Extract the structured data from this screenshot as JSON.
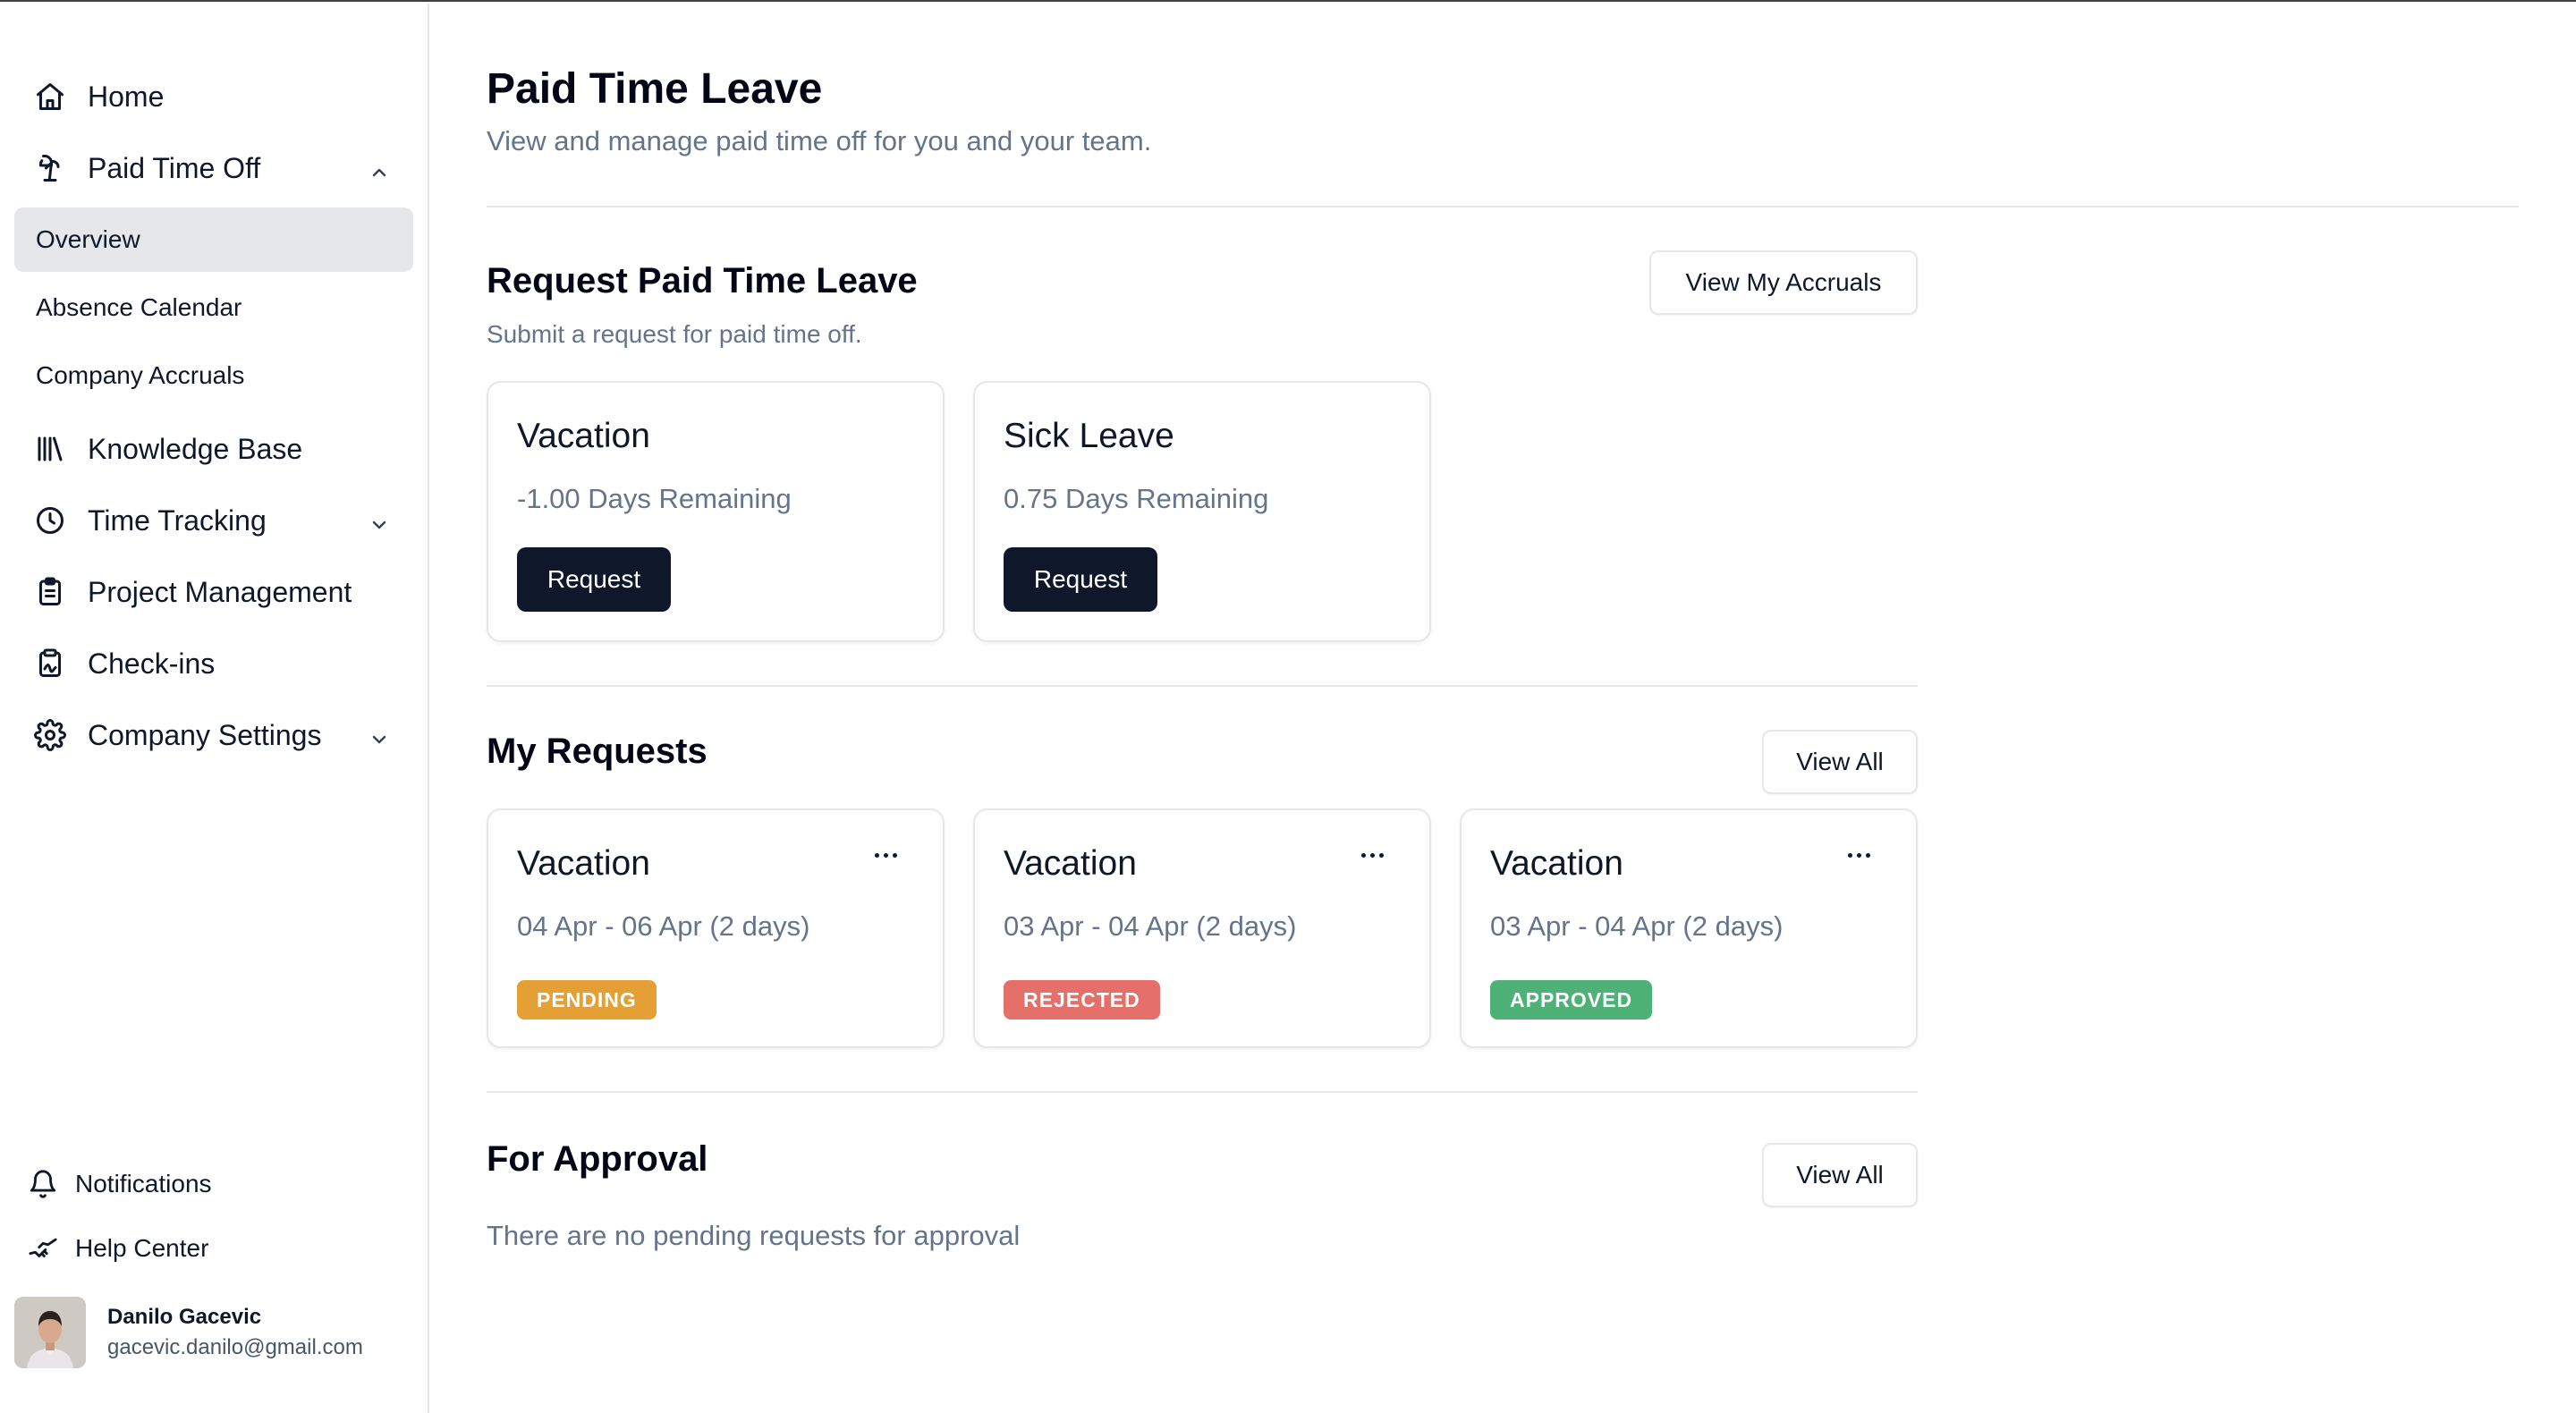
{
  "sidebar": {
    "nav": [
      {
        "label": "Home",
        "icon": "home-icon"
      },
      {
        "label": "Paid Time Off",
        "icon": "palm-tree-icon",
        "expanded": true
      },
      {
        "label": "Knowledge Base",
        "icon": "library-icon"
      },
      {
        "label": "Time Tracking",
        "icon": "clock-icon",
        "expanded": false
      },
      {
        "label": "Project Management",
        "icon": "clipboard-icon"
      },
      {
        "label": "Check-ins",
        "icon": "clipboard-signature-icon"
      },
      {
        "label": "Company Settings",
        "icon": "gear-icon",
        "expanded": false
      }
    ],
    "pto_sub": [
      {
        "label": "Overview",
        "active": true
      },
      {
        "label": "Absence Calendar"
      },
      {
        "label": "Company Accruals"
      }
    ],
    "bottom": [
      {
        "label": "Notifications",
        "icon": "bell-icon"
      },
      {
        "label": "Help Center",
        "icon": "handshake-icon"
      }
    ],
    "user": {
      "name": "Danilo Gacevic",
      "email": "gacevic.danilo@gmail.com"
    }
  },
  "page": {
    "title": "Paid Time Leave",
    "subtitle": "View and manage paid time off for you and your team."
  },
  "request_section": {
    "title": "Request Paid Time Leave",
    "subtitle": "Submit a request for paid time off.",
    "button": "View My Accruals",
    "cards": [
      {
        "title": "Vacation",
        "remaining": "-1.00 Days Remaining",
        "button": "Request"
      },
      {
        "title": "Sick Leave",
        "remaining": "0.75 Days Remaining",
        "button": "Request"
      }
    ]
  },
  "my_requests": {
    "title": "My Requests",
    "button": "View All",
    "cards": [
      {
        "title": "Vacation",
        "dates": "04 Apr - 06 Apr (2 days)",
        "status": "PENDING",
        "status_color": "#e5a035"
      },
      {
        "title": "Vacation",
        "dates": "03 Apr - 04 Apr (2 days)",
        "status": "REJECTED",
        "status_color": "#e5706a"
      },
      {
        "title": "Vacation",
        "dates": "03 Apr - 04 Apr (2 days)",
        "status": "APPROVED",
        "status_color": "#4eb276"
      }
    ]
  },
  "for_approval": {
    "title": "For Approval",
    "button": "View All",
    "empty_text": "There are no pending requests for approval"
  }
}
